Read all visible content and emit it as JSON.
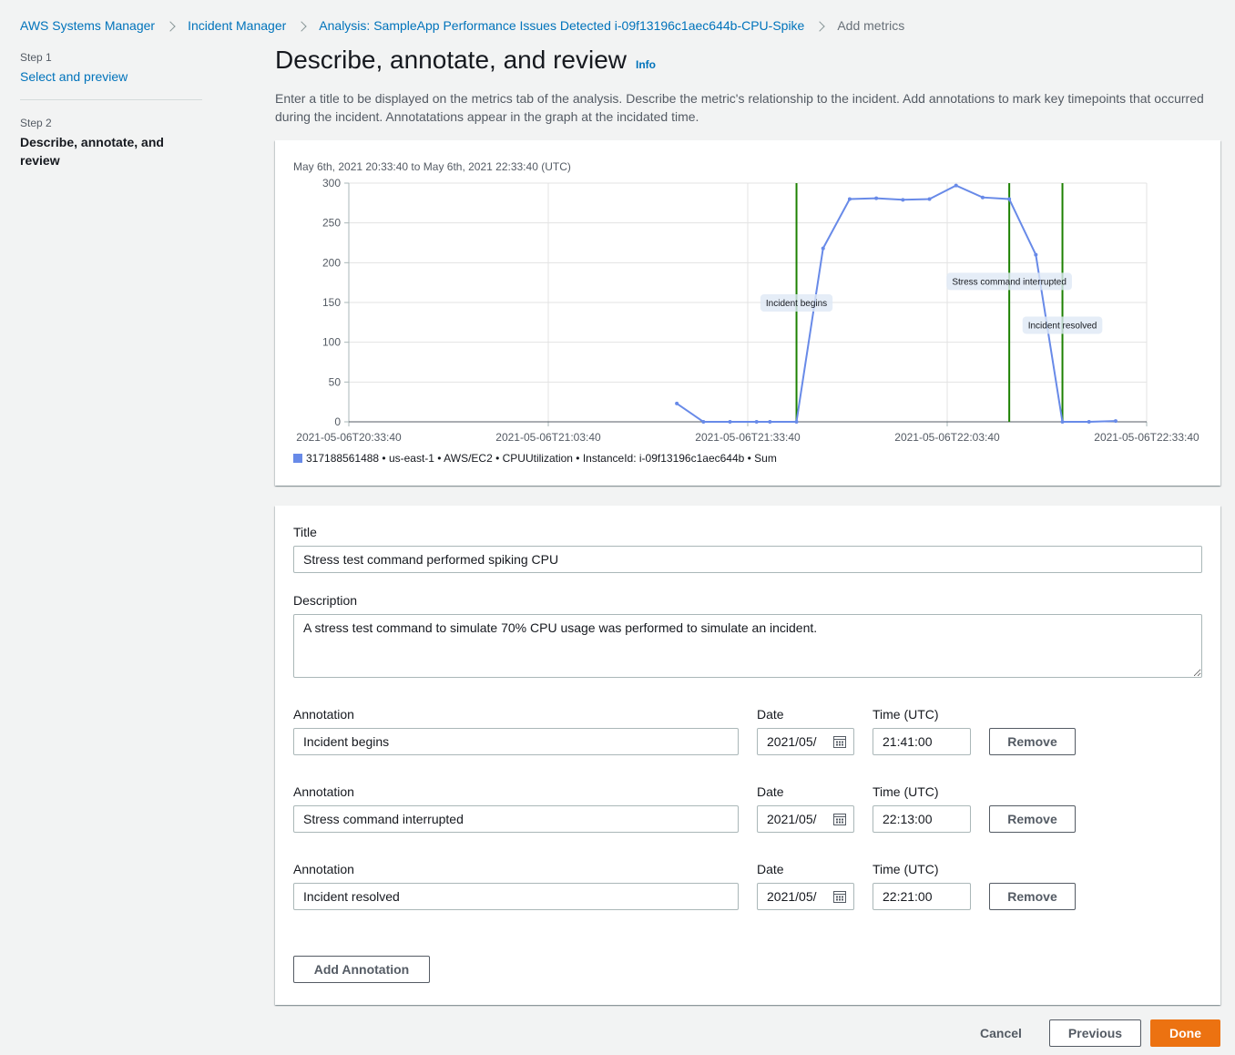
{
  "breadcrumb": [
    {
      "label": "AWS Systems Manager"
    },
    {
      "label": "Incident Manager"
    },
    {
      "label": "Analysis: SampleApp Performance Issues Detected i-09f13196c1aec644b-CPU-Spike"
    },
    {
      "label": "Add metrics"
    }
  ],
  "steps": [
    {
      "num": "Step 1",
      "label": "Select and preview"
    },
    {
      "num": "Step 2",
      "label": "Describe, annotate, and review"
    }
  ],
  "page": {
    "title": "Describe, annotate, and review",
    "info": "Info",
    "description": "Enter a title to be displayed on the metrics tab of the analysis. Describe the metric's relationship to the incident. Add annotations to mark key timepoints that occurred during the incident. Annotatations appear in the graph at the incidated time."
  },
  "chart_data": {
    "type": "line",
    "range_label": "May 6th, 2021 20:33:40 to May 6th, 2021 22:33:40 (UTC)",
    "x_ticks": [
      "2021-05-06T20:33:40",
      "2021-05-06T21:03:40",
      "2021-05-06T21:33:40",
      "2021-05-06T22:03:40",
      "2021-05-06T22:33:40"
    ],
    "xlim": [
      "2021-05-06T20:33:40",
      "2021-05-06T22:33:40"
    ],
    "y_ticks": [
      0,
      50,
      100,
      150,
      200,
      250,
      300
    ],
    "ylim": [
      0,
      300
    ],
    "grid": true,
    "series": [
      {
        "name": "317188561488 • us-east-1 • AWS/EC2 • CPUUtilization • InstanceId: i-09f13196c1aec644b • Sum",
        "color": "#688ae8",
        "points": [
          [
            "2021-05-06T21:23:00",
            23
          ],
          [
            "2021-05-06T21:27:00",
            0
          ],
          [
            "2021-05-06T21:31:00",
            0
          ],
          [
            "2021-05-06T21:35:00",
            0
          ],
          [
            "2021-05-06T21:37:00",
            0
          ],
          [
            "2021-05-06T21:41:00",
            0
          ],
          [
            "2021-05-06T21:45:00",
            218
          ],
          [
            "2021-05-06T21:49:00",
            280
          ],
          [
            "2021-05-06T21:53:00",
            281
          ],
          [
            "2021-05-06T21:57:00",
            279
          ],
          [
            "2021-05-06T22:01:00",
            280
          ],
          [
            "2021-05-06T22:05:00",
            297
          ],
          [
            "2021-05-06T22:09:00",
            282
          ],
          [
            "2021-05-06T22:13:00",
            280
          ],
          [
            "2021-05-06T22:17:00",
            210
          ],
          [
            "2021-05-06T22:21:00",
            0
          ],
          [
            "2021-05-06T22:25:00",
            0
          ],
          [
            "2021-05-06T22:29:00",
            1
          ]
        ]
      }
    ],
    "annotations": [
      {
        "time": "2021-05-06T21:41:00",
        "label": "Incident begins",
        "label_y": 150,
        "color": "#1d8102"
      },
      {
        "time": "2021-05-06T22:13:00",
        "label": "Stress command interrupted",
        "label_y": 177,
        "color": "#1d8102"
      },
      {
        "time": "2021-05-06T22:21:00",
        "label": "Incident resolved",
        "label_y": 122,
        "color": "#1d8102"
      }
    ],
    "legend": "bottom-left"
  },
  "form": {
    "title_label": "Title",
    "title_value": "Stress test command performed spiking CPU",
    "description_label": "Description",
    "description_value": "A stress test command to simulate 70% CPU usage was performed to simulate an incident.",
    "annotation_label": "Annotation",
    "date_label": "Date",
    "time_label": "Time (UTC)",
    "remove_label": "Remove",
    "annotations": [
      {
        "name": "Incident begins",
        "date": "2021/05/",
        "time": "21:41:00"
      },
      {
        "name": "Stress command interrupted",
        "date": "2021/05/",
        "time": "22:13:00"
      },
      {
        "name": "Incident resolved",
        "date": "2021/05/",
        "time": "22:21:00"
      }
    ],
    "add_annotation_label": "Add Annotation"
  },
  "footer": {
    "cancel_label": "Cancel",
    "previous_label": "Previous",
    "done_label": "Done"
  }
}
